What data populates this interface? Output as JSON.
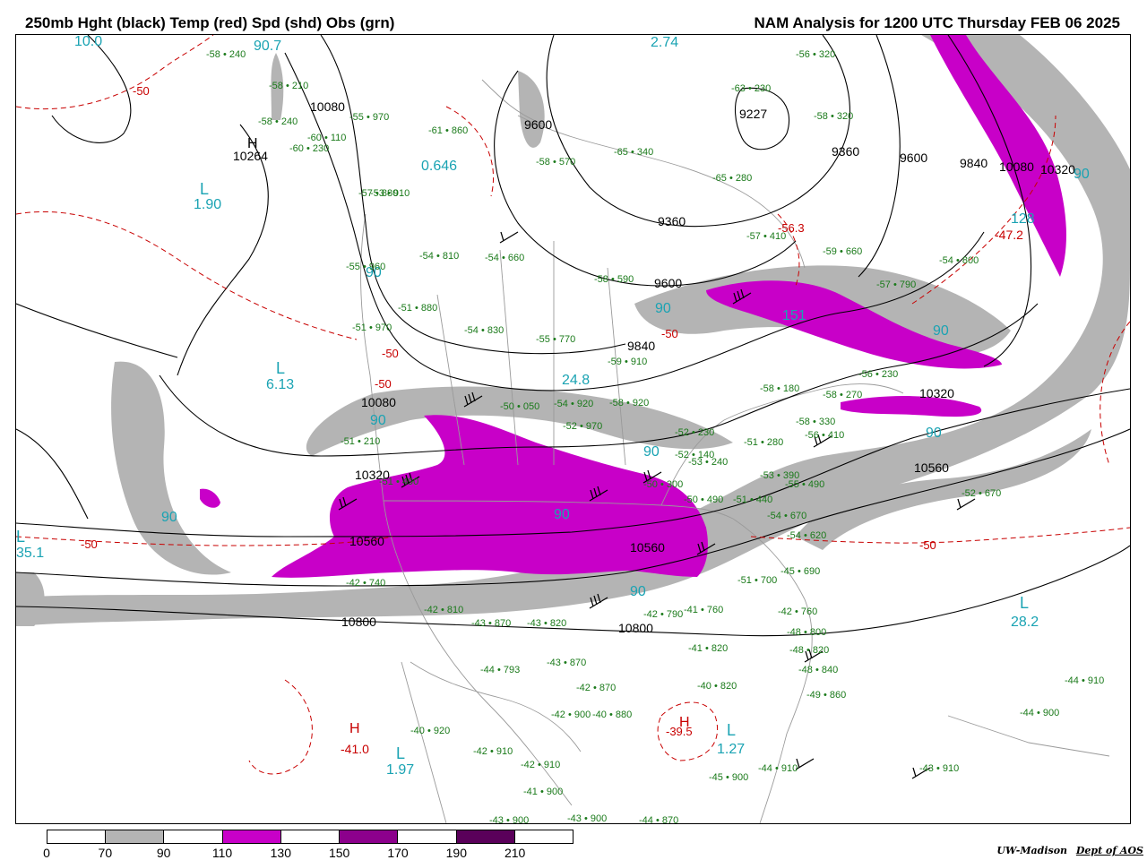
{
  "header": {
    "left_title": "250mb Hght (black) Temp (red) Spd (shd) Obs (grn)",
    "right_title": "NAM Analysis for 1200 UTC Thursday  FEB 06 2025"
  },
  "legend": {
    "colors": [
      "#ffffff",
      "#b4b4b4",
      "#ffffff",
      "#c800c8",
      "#ffffff",
      "#8c008c",
      "#ffffff",
      "#5a005a",
      "#ffffff"
    ],
    "ticks": [
      "0",
      "70",
      "90",
      "110",
      "130",
      "150",
      "170",
      "190",
      "210"
    ]
  },
  "credit": {
    "org": "UW-Madison",
    "dept": "Dept of AOS"
  },
  "map": {
    "height_labels": [
      "10080",
      "9600",
      "9227",
      "9360",
      "9600",
      "9840",
      "10080",
      "10320",
      "10264",
      "9360",
      "9600",
      "9840",
      "10080",
      "10320",
      "10560",
      "10320",
      "10560",
      "10560",
      "10800",
      "10800"
    ],
    "pressure_centers": [
      {
        "type": "H",
        "value": "10264"
      },
      {
        "type": "L",
        "value": "1.90"
      },
      {
        "type": "L",
        "value": "6.13"
      },
      {
        "type": "L",
        "value": "35.1"
      },
      {
        "type": "H",
        "value": "-41.0"
      },
      {
        "type": "L",
        "value": "1.97"
      },
      {
        "type": "L",
        "value": "1.27"
      },
      {
        "type": "H",
        "value": "-39.5"
      },
      {
        "type": "L",
        "value": "28.2"
      },
      {
        "type": "H",
        "value": "-47.2"
      },
      {
        "type": "L",
        "value": "24.8"
      },
      {
        "type": "H",
        "value": "-56.3"
      }
    ],
    "speed_labels": [
      "10.0",
      "90.7",
      "2.74",
      "0.646",
      "90",
      "90",
      "90",
      "90",
      "90",
      "90",
      "128",
      "151",
      "90",
      "90",
      "90",
      "90"
    ],
    "temp_labels": [
      "-50",
      "-50",
      "-50",
      "-50",
      "-50",
      "-50"
    ],
    "observations": [
      "-58 240",
      "-58 210",
      "-58 240",
      "-60 110",
      "-55 970",
      "-60 230",
      "-57 880",
      "-53 910",
      "-55 960",
      "-51 880",
      "-51 970",
      "-54 810",
      "-54 660",
      "-54 830",
      "-55 770",
      "-59 910",
      "-58 920",
      "-58 590",
      "-61 860",
      "-58 570",
      "-65 340",
      "-65 280",
      "-63 230",
      "-58 320",
      "-56 320",
      "-57 410",
      "-59 660",
      "-54 800",
      "-57 790",
      "-58 180",
      "-58 270",
      "-56 410",
      "-58 330",
      "-56 230",
      "-52 670",
      "-54 670",
      "-54 620",
      "-53 390",
      "-55 490",
      "-45 690",
      "-51 700",
      "-42 760",
      "-48 800",
      "-48 820",
      "-48 840",
      "-49 860",
      "-44 910",
      "-44 900",
      "-43 910",
      "-45 900",
      "-44 910",
      "-42 740",
      "-42 810",
      "-43 870",
      "-43 820",
      "-44 793",
      "-43 870",
      "-42 870",
      "-42 900",
      "-40 880",
      "-40 920",
      "-42 910",
      "-42 910",
      "-41 900",
      "-43 900",
      "-43 900",
      "-44 870",
      "-41 820",
      "-40 820",
      "-42 790",
      "-41 760",
      "-51 440",
      "-50 490",
      "-50 300",
      "-52 230",
      "-52 140",
      "-53 240",
      "-51 280",
      "-50 050",
      "-54 920",
      "-52 970",
      "-51 210",
      "-51 490"
    ]
  }
}
